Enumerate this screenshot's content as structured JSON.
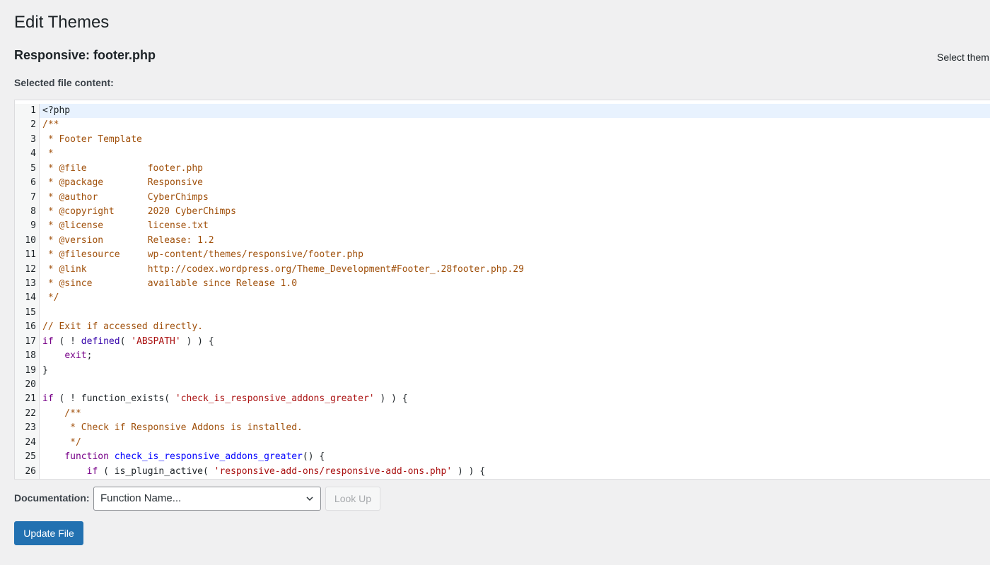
{
  "page": {
    "title": "Edit Themes",
    "file_heading": "Responsive: footer.php",
    "select_theme_label": "Select them",
    "selected_file_label": "Selected file content:"
  },
  "editor": {
    "lines": [
      {
        "n": "1",
        "active": true,
        "tokens": [
          {
            "t": "<?php",
            "c": "plain"
          }
        ]
      },
      {
        "n": "2",
        "tokens": [
          {
            "t": "/**",
            "c": "comment"
          }
        ]
      },
      {
        "n": "3",
        "tokens": [
          {
            "t": " * Footer Template",
            "c": "comment"
          }
        ]
      },
      {
        "n": "4",
        "tokens": [
          {
            "t": " *",
            "c": "comment"
          }
        ]
      },
      {
        "n": "5",
        "tokens": [
          {
            "t": " * @file           footer.php",
            "c": "comment"
          }
        ]
      },
      {
        "n": "6",
        "tokens": [
          {
            "t": " * @package        Responsive",
            "c": "comment"
          }
        ]
      },
      {
        "n": "7",
        "tokens": [
          {
            "t": " * @author         CyberChimps",
            "c": "comment"
          }
        ]
      },
      {
        "n": "8",
        "tokens": [
          {
            "t": " * @copyright      2020 CyberChimps",
            "c": "comment"
          }
        ]
      },
      {
        "n": "9",
        "tokens": [
          {
            "t": " * @license        license.txt",
            "c": "comment"
          }
        ]
      },
      {
        "n": "10",
        "tokens": [
          {
            "t": " * @version        Release: 1.2",
            "c": "comment"
          }
        ]
      },
      {
        "n": "11",
        "tokens": [
          {
            "t": " * @filesource     wp-content/themes/responsive/footer.php",
            "c": "comment"
          }
        ]
      },
      {
        "n": "12",
        "tokens": [
          {
            "t": " * @link           http://codex.wordpress.org/Theme_Development#Footer_.28footer.php.29",
            "c": "comment"
          }
        ]
      },
      {
        "n": "13",
        "tokens": [
          {
            "t": " * @since          available since Release 1.0",
            "c": "comment"
          }
        ]
      },
      {
        "n": "14",
        "tokens": [
          {
            "t": " */",
            "c": "comment"
          }
        ]
      },
      {
        "n": "15",
        "tokens": [
          {
            "t": "",
            "c": "plain"
          }
        ]
      },
      {
        "n": "16",
        "tokens": [
          {
            "t": "// Exit if accessed directly.",
            "c": "comment"
          }
        ]
      },
      {
        "n": "17",
        "tokens": [
          {
            "t": "if",
            "c": "keyword"
          },
          {
            "t": " ( ! ",
            "c": "plain"
          },
          {
            "t": "defined",
            "c": "builtin"
          },
          {
            "t": "( ",
            "c": "plain"
          },
          {
            "t": "'ABSPATH'",
            "c": "string"
          },
          {
            "t": " ) ) {",
            "c": "plain"
          }
        ]
      },
      {
        "n": "18",
        "tokens": [
          {
            "t": "    ",
            "c": "plain"
          },
          {
            "t": "exit",
            "c": "keyword"
          },
          {
            "t": ";",
            "c": "plain"
          }
        ]
      },
      {
        "n": "19",
        "tokens": [
          {
            "t": "}",
            "c": "plain"
          }
        ]
      },
      {
        "n": "20",
        "tokens": [
          {
            "t": "",
            "c": "plain"
          }
        ]
      },
      {
        "n": "21",
        "tokens": [
          {
            "t": "if",
            "c": "keyword"
          },
          {
            "t": " ( ! function_exists( ",
            "c": "plain"
          },
          {
            "t": "'check_is_responsive_addons_greater'",
            "c": "string"
          },
          {
            "t": " ) ) {",
            "c": "plain"
          }
        ]
      },
      {
        "n": "22",
        "tokens": [
          {
            "t": "    /**",
            "c": "comment"
          }
        ]
      },
      {
        "n": "23",
        "tokens": [
          {
            "t": "     * Check if Responsive Addons is installed.",
            "c": "comment"
          }
        ]
      },
      {
        "n": "24",
        "tokens": [
          {
            "t": "     */",
            "c": "comment"
          }
        ]
      },
      {
        "n": "25",
        "tokens": [
          {
            "t": "    ",
            "c": "plain"
          },
          {
            "t": "function",
            "c": "keyword"
          },
          {
            "t": " ",
            "c": "plain"
          },
          {
            "t": "check_is_responsive_addons_greater",
            "c": "def"
          },
          {
            "t": "() {",
            "c": "plain"
          }
        ]
      },
      {
        "n": "26",
        "tokens": [
          {
            "t": "        ",
            "c": "plain"
          },
          {
            "t": "if",
            "c": "keyword"
          },
          {
            "t": " ( is_plugin_active( ",
            "c": "plain"
          },
          {
            "t": "'responsive-add-ons/responsive-add-ons.php'",
            "c": "string"
          },
          {
            "t": " ) ) {",
            "c": "plain"
          }
        ]
      }
    ]
  },
  "documentation": {
    "label": "Documentation:",
    "select_value": "Function Name...",
    "lookup_label": "Look Up"
  },
  "actions": {
    "update_label": "Update File"
  },
  "colors": {
    "accent": "#2271b1",
    "background": "#f0f0f1",
    "active_line": "#e8f2fe"
  }
}
